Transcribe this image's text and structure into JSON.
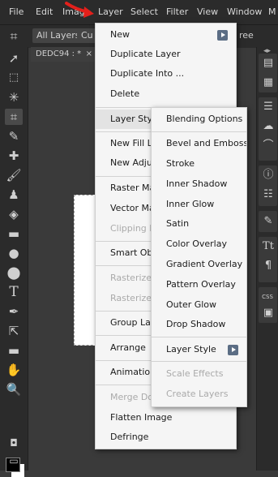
{
  "menubar": {
    "items": [
      "File",
      "Edit",
      "Image",
      "Layer",
      "Select",
      "Filter",
      "View",
      "Window",
      "M"
    ]
  },
  "optbar": {
    "items": [
      "All Layers",
      "Cu",
      "ree"
    ]
  },
  "doc": {
    "tab_label": "DEDC94 : *",
    "close_glyph": "×"
  },
  "colors": {
    "annotation_arrow": "#e3201b",
    "menu_bg": "#f5f5f5",
    "submenu_arrow": "#5b6d84"
  },
  "layer_menu": {
    "items": [
      {
        "label": "New",
        "has_submenu": true
      },
      {
        "label": "Duplicate Layer"
      },
      {
        "label": "Duplicate Into ..."
      },
      {
        "label": "Delete"
      },
      {
        "label": "Layer Style",
        "highlighted": true
      },
      {
        "label": "New Fill La"
      },
      {
        "label": "New Adjus"
      },
      {
        "label": "Raster Ma"
      },
      {
        "label": "Vector Ma"
      },
      {
        "label": "Clipping M",
        "disabled": true
      },
      {
        "label": "Smart Obje"
      },
      {
        "label": "Rasterize",
        "disabled": true
      },
      {
        "label": "Rasterize L",
        "disabled": true
      },
      {
        "label": "Group Lay"
      },
      {
        "label": "Arrange"
      },
      {
        "label": "Animation"
      },
      {
        "label": "Merge Dov",
        "disabled": true
      },
      {
        "label": "Flatten Image"
      },
      {
        "label": "Defringe"
      }
    ]
  },
  "style_submenu": {
    "items": [
      {
        "label": "Blending Options"
      },
      {
        "label": "Bevel and Emboss"
      },
      {
        "label": "Stroke"
      },
      {
        "label": "Inner Shadow"
      },
      {
        "label": "Inner Glow"
      },
      {
        "label": "Satin"
      },
      {
        "label": "Color Overlay"
      },
      {
        "label": "Gradient Overlay"
      },
      {
        "label": "Pattern Overlay"
      },
      {
        "label": "Outer Glow"
      },
      {
        "label": "Drop Shadow"
      },
      {
        "label": "Layer Style",
        "has_submenu": true
      },
      {
        "label": "Scale Effects",
        "disabled": true
      },
      {
        "label": "Create Layers",
        "disabled": true
      }
    ]
  },
  "right_panel": {
    "text_icon": "Tt",
    "para_icon": "¶",
    "css_label": "CSS"
  }
}
